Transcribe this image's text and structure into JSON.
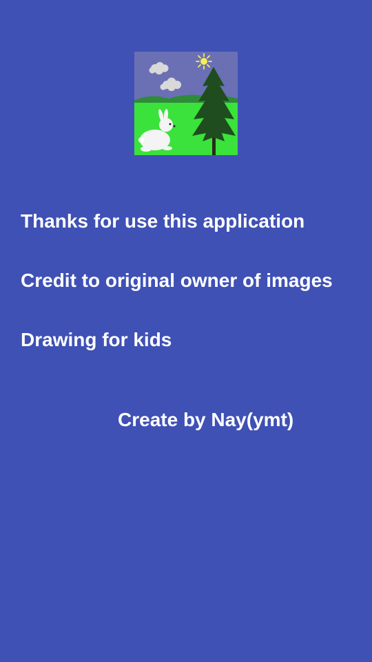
{
  "about": {
    "image_description": "drawing-image",
    "lines": [
      "Thanks for use this application",
      "Credit to original owner of images",
      "Drawing for kids"
    ],
    "creator": "Create by Nay(ymt)"
  },
  "colors": {
    "background": "#3f51b5",
    "text": "#ffffff",
    "sky": "#6b70b5",
    "grass": "#3be23b",
    "tree": "#1f4d1f",
    "sun": "#f5ef55"
  }
}
